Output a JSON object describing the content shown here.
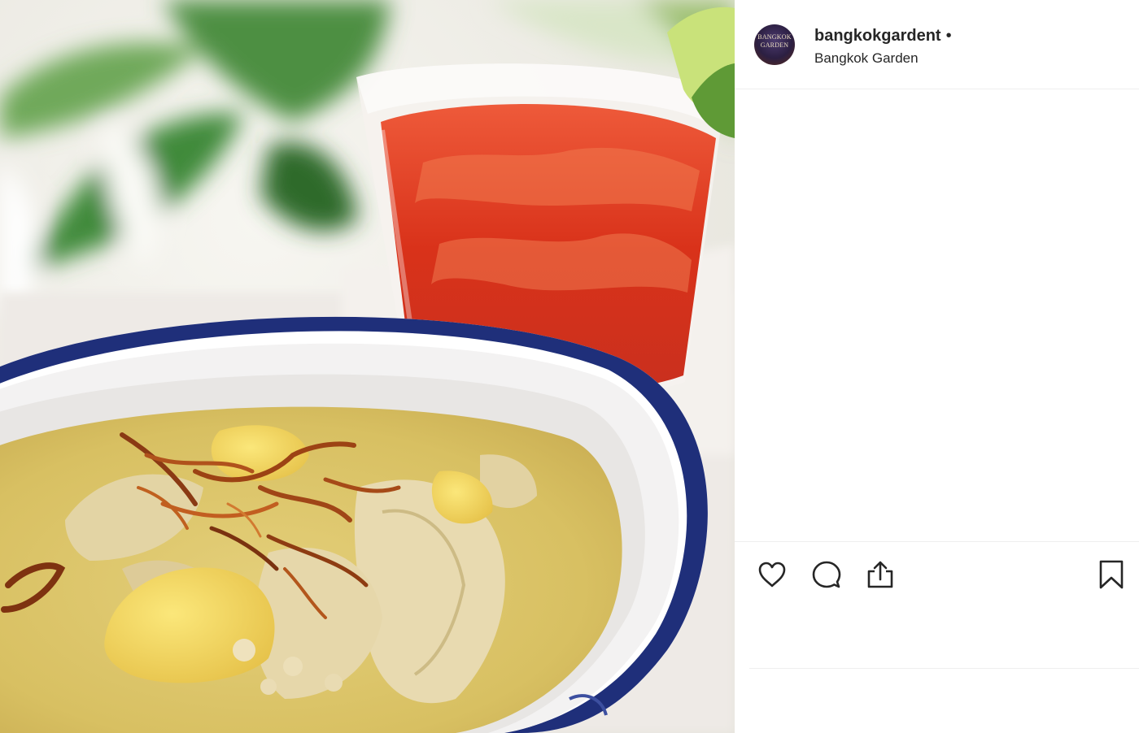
{
  "post": {
    "username": "bangkokgardent",
    "separator": "•",
    "location": "Bangkok Garden",
    "avatar_text": [
      "BANGKOK",
      "GARDEN"
    ]
  },
  "photo": {
    "subject": "bowl of yellow curry with chicken, potatoes and fried shallots beside a glass of red iced tea"
  },
  "actions": {
    "like_icon": "heart-icon",
    "comment_icon": "comment-icon",
    "share_icon": "share-icon",
    "save_icon": "bookmark-icon"
  },
  "colors": {
    "text": "#262626",
    "divider": "#efefef",
    "bowl_rim": "#1f2f7a",
    "curry": "#d9c16a",
    "drink": "#d8341e"
  }
}
